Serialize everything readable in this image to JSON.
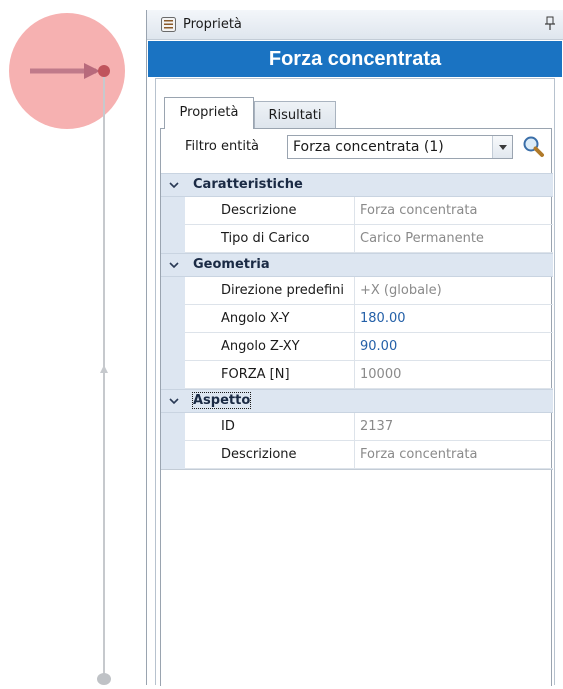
{
  "panel": {
    "title": "Proprietà",
    "entity_name": "Forza concentrata"
  },
  "tabs": [
    {
      "label": "Proprietà",
      "active": true
    },
    {
      "label": "Risultati",
      "active": false
    }
  ],
  "filter": {
    "label": "Filtro entità",
    "value": "Forza concentrata (1)"
  },
  "categories": [
    {
      "label": "Caratteristiche",
      "rows": [
        {
          "name": "Descrizione",
          "value": "Forza concentrata",
          "editable": false
        },
        {
          "name": "Tipo di Carico",
          "value": "Carico Permanente",
          "editable": false
        }
      ]
    },
    {
      "label": "Geometria",
      "rows": [
        {
          "name": "Direzione predefini",
          "value": "+X (globale)",
          "editable": false
        },
        {
          "name": "Angolo X-Y",
          "value": "180.00",
          "editable": true
        },
        {
          "name": "Angolo Z-XY",
          "value": "90.00",
          "editable": true
        },
        {
          "name": "FORZA  [N]",
          "value": "10000",
          "editable": false
        }
      ]
    },
    {
      "label": "Aspetto",
      "rows": [
        {
          "name": "ID",
          "value": "2137",
          "editable": false
        },
        {
          "name": "Descrizione",
          "value": "Forza concentrata",
          "editable": false
        }
      ]
    }
  ],
  "colors": {
    "banner": "#1a73c2",
    "category_bg": "#dde6f1",
    "editable_value": "#2460a8",
    "readonly_value": "#8a8a8a",
    "highlight_circle": "#f5a3a3",
    "force_arrow": "#c07a8a"
  },
  "icons": [
    "properties-panel-icon",
    "pin-icon",
    "chevron-down-icon",
    "search-icon",
    "dropdown-arrow-icon"
  ]
}
